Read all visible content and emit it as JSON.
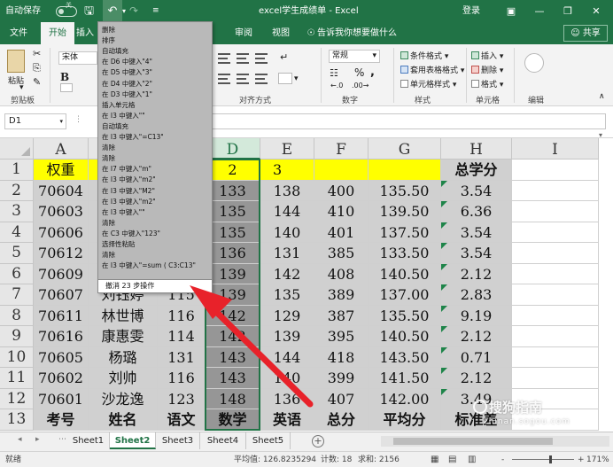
{
  "titlebar": {
    "autosave_label": "自动保存",
    "autosave_state": "关",
    "window_title": "excel学生成绩单 - Excel",
    "login_label": "登录",
    "icons": [
      "save-icon",
      "undo-icon",
      "redo-icon",
      "customize-icon",
      "ribbon-display-icon",
      "minimize-icon",
      "restore-icon",
      "close-icon"
    ]
  },
  "ribbon_tabs": [
    "文件",
    "开始",
    "插入",
    "审阅",
    "视图"
  ],
  "tell_me": "告诉我你想要做什么",
  "share_label": "共享",
  "ribbon": {
    "paste_label": "粘贴",
    "clipboard_group": "剪贴板",
    "font_name": "宋体",
    "bold_label": "B",
    "alignment_group": "对齐方式",
    "number_format": "常规",
    "percent_label": "%",
    "comma_label": ",",
    "number_group": "数字",
    "conditional_format": "条件格式",
    "table_format": "套用表格格式",
    "cell_styles": "单元格样式",
    "styles_group": "样式",
    "insert_label": "插入",
    "delete_label": "删除",
    "format_label": "格式",
    "cells_group": "单元格",
    "editing_group": "编辑",
    "dropdown_glyph": "▾"
  },
  "formula_bar": {
    "name_box": "D1",
    "dropdown_glyph": "▾"
  },
  "undo_list": {
    "items": [
      "删除",
      "排序",
      "自动填充",
      "在 D6 中键入\"4\"",
      "在 D5 中键入\"3\"",
      "在 D4 中键入\"2\"",
      "在 D3 中键入\"1\"",
      "插入单元格",
      "在 I3 中键入\"\"",
      "自动填充",
      "在 I3 中键入\"=C13\"",
      "清除",
      "清除",
      "在 I7 中键入\"m\"",
      "在 I3 中键入\"m2\"",
      "在 I3 中键入\"M2\"",
      "在 I3 中键入\"m2\"",
      "在 I3 中键入\"\"",
      "清除",
      "在 C3 中键入\"123\"",
      "选择性粘贴",
      "清除",
      "在 I3 中键入\"=sum ( C3:C13\""
    ],
    "footer": "撤消 23 步操作"
  },
  "grid": {
    "columns": [
      "A",
      "B",
      "C",
      "D",
      "E",
      "F",
      "G",
      "H",
      "I"
    ],
    "rows": [
      "1",
      "2",
      "3",
      "4",
      "5",
      "6",
      "7",
      "8",
      "9",
      "10",
      "11",
      "12",
      "13"
    ],
    "row1": {
      "a": "权重",
      "b": "",
      "c": "",
      "d": "2",
      "e": "3",
      "h": "总学分"
    },
    "data": [
      {
        "a": "70604",
        "b": "",
        "c": "",
        "d": "133",
        "e": "138",
        "f": "400",
        "g": "135.50",
        "h": "3.54"
      },
      {
        "a": "70603",
        "b": "",
        "c": "",
        "d": "135",
        "e": "144",
        "f": "410",
        "g": "139.50",
        "h": "6.36"
      },
      {
        "a": "70606",
        "b": "",
        "c": "",
        "d": "135",
        "e": "140",
        "f": "401",
        "g": "137.50",
        "h": "3.54"
      },
      {
        "a": "70612",
        "b": "",
        "c": "",
        "d": "136",
        "e": "131",
        "f": "385",
        "g": "133.50",
        "h": "3.54"
      },
      {
        "a": "70609",
        "b": "",
        "c": "",
        "d": "139",
        "e": "142",
        "f": "408",
        "g": "140.50",
        "h": "2.12"
      },
      {
        "a": "70607",
        "b": "刘钰婷",
        "c": "115",
        "d": "139",
        "e": "135",
        "f": "389",
        "g": "137.00",
        "h": "2.83"
      },
      {
        "a": "70611",
        "b": "林世博",
        "c": "116",
        "d": "142",
        "e": "129",
        "f": "387",
        "g": "135.50",
        "h": "9.19"
      },
      {
        "a": "70616",
        "b": "康惠雯",
        "c": "114",
        "d": "142",
        "e": "139",
        "f": "395",
        "g": "140.50",
        "h": "2.12"
      },
      {
        "a": "70605",
        "b": "杨璐",
        "c": "131",
        "d": "143",
        "e": "144",
        "f": "418",
        "g": "143.50",
        "h": "0.71"
      },
      {
        "a": "70602",
        "b": "刘帅",
        "c": "116",
        "d": "143",
        "e": "140",
        "f": "399",
        "g": "141.50",
        "h": "2.12"
      },
      {
        "a": "70601",
        "b": "沙龙逸",
        "c": "123",
        "d": "148",
        "e": "136",
        "f": "407",
        "g": "142.00",
        "h": "3.49"
      }
    ],
    "row13": {
      "a": "考号",
      "b": "姓名",
      "c": "语文",
      "d": "数学",
      "e": "英语",
      "f": "总分",
      "g": "平均分",
      "h": "标准差"
    }
  },
  "sheets": {
    "tabs": [
      "Sheet1",
      "Sheet2",
      "Sheet3",
      "Sheet4",
      "Sheet5"
    ],
    "active": "Sheet2",
    "add_glyph": "+"
  },
  "statusbar": {
    "ready": "就绪",
    "average": "平均值: 126.8235294",
    "count": "计数: 18",
    "sum": "求和: 2156",
    "zoom": "171%",
    "zoom_minus": "-",
    "zoom_plus": "+"
  },
  "watermark": {
    "main": "搜狗指南",
    "sub": "zhinan.sogou.com"
  },
  "colors": {
    "excel_green": "#217346",
    "yellow": "#ffff00",
    "arrow_red": "#e8222a",
    "shade": "#d0d0d0"
  }
}
